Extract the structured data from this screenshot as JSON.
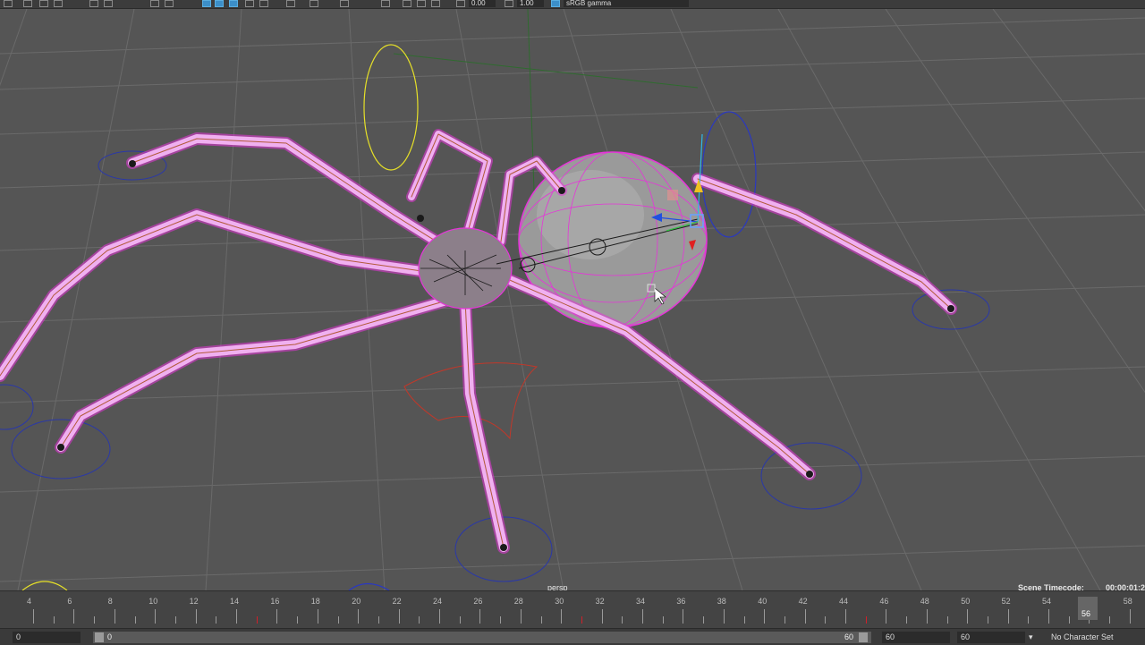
{
  "toolbar": {
    "value1": "0.00",
    "value2": "1.00",
    "colorspace": "sRGB gamma"
  },
  "viewport": {
    "camera": "persp",
    "timecode_label": "Scene Timecode:",
    "timecode_value": "00:00:01:2"
  },
  "timeline": {
    "tick_labels": [
      "4",
      "6",
      "8",
      "10",
      "12",
      "14",
      "16",
      "18",
      "20",
      "22",
      "24",
      "26",
      "28",
      "30",
      "32",
      "34",
      "36",
      "38",
      "40",
      "42",
      "44",
      "46",
      "48",
      "50",
      "52",
      "54",
      "56",
      "58"
    ],
    "current_frame": "56"
  },
  "range": {
    "start": "0",
    "inner_start": "0",
    "inner_end": "60",
    "end_a": "60",
    "end_b": "60",
    "character_set": "No Character Set"
  },
  "colors": {
    "wire": "#e535d8",
    "joint": "#b25a3a",
    "key": "#d0202a",
    "grid": "#6a6a6a"
  }
}
